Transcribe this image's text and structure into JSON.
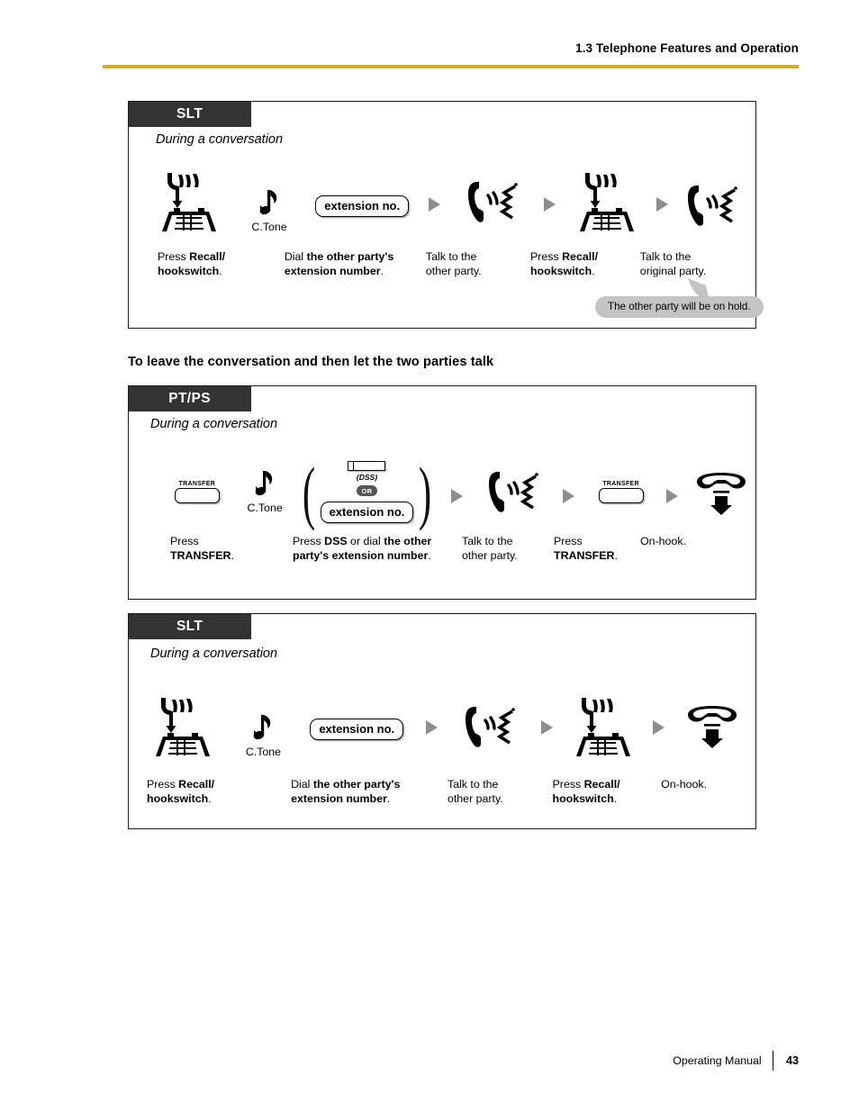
{
  "header": {
    "title": "1.3 Telephone Features and Operation",
    "rule_color": "#d4af16"
  },
  "section_heading": "To leave the conversation and then let the two parties talk",
  "boxes": [
    {
      "tab_label": "SLT",
      "state_label": "During a conversation",
      "steps": [
        {
          "icon": "recall-hookswitch-icon",
          "label": ""
        },
        {
          "icon": "c-tone-icon",
          "label": "C.Tone"
        },
        {
          "icon": "extension-no-pill",
          "label": "extension no."
        },
        {
          "icon": "talk-icon",
          "label": ""
        },
        {
          "icon": "recall-hookswitch-icon",
          "label": ""
        },
        {
          "icon": "talk-icon",
          "label": ""
        }
      ],
      "captions": [
        {
          "lead": "Press ",
          "strong": "Recall/",
          "strong2": "hookswitch",
          "tail": "."
        },
        {
          "lead": "Dial ",
          "strong": "the other party's",
          "strong2": "extension number",
          "tail": "."
        },
        {
          "plain1": "Talk to the",
          "plain2": "other party."
        },
        {
          "lead": "Press ",
          "strong": "Recall/",
          "strong2": "hookswitch",
          "tail": "."
        },
        {
          "plain1": "Talk to the",
          "plain2": "original party."
        }
      ],
      "callout": "The other party will be on hold."
    },
    {
      "tab_label": "PT/PS",
      "state_label": "During a conversation",
      "steps": [
        {
          "icon": "transfer-key",
          "label": "TRANSFER"
        },
        {
          "icon": "c-tone-icon",
          "label": "C.Tone"
        },
        {
          "icon": "dss-or-extension-group",
          "label": "(DSS)",
          "or_label": "OR",
          "pill_label": "extension no."
        },
        {
          "icon": "talk-icon",
          "label": ""
        },
        {
          "icon": "transfer-key",
          "label": "TRANSFER"
        },
        {
          "icon": "on-hook-icon",
          "label": ""
        }
      ],
      "captions": [
        {
          "plain1": "Press",
          "strongline": "TRANSFER",
          "tail": "."
        },
        {
          "lead": "Press ",
          "strong": "DSS",
          "mid": " or dial ",
          "strong2": "the other",
          "strong3": "party's extension number",
          "tail": "."
        },
        {
          "plain1": "Talk to the",
          "plain2": "other party."
        },
        {
          "plain1": "Press",
          "strongline": "TRANSFER",
          "tail": "."
        },
        {
          "plain1": "On-hook."
        }
      ]
    },
    {
      "tab_label": "SLT",
      "state_label": "During a conversation",
      "steps": [
        {
          "icon": "recall-hookswitch-icon",
          "label": ""
        },
        {
          "icon": "c-tone-icon",
          "label": "C.Tone"
        },
        {
          "icon": "extension-no-pill",
          "label": "extension no."
        },
        {
          "icon": "talk-icon",
          "label": ""
        },
        {
          "icon": "recall-hookswitch-icon",
          "label": ""
        },
        {
          "icon": "on-hook-icon",
          "label": ""
        }
      ],
      "captions": [
        {
          "lead": "Press ",
          "strong": "Recall/",
          "strong2": "hookswitch",
          "tail": "."
        },
        {
          "lead": "Dial ",
          "strong": "the other party's",
          "strong2": "extension number",
          "tail": "."
        },
        {
          "plain1": "Talk to the",
          "plain2": "other party."
        },
        {
          "lead": "Press ",
          "strong": "Recall/",
          "strong2": "hookswitch",
          "tail": "."
        },
        {
          "plain1": "On-hook."
        }
      ]
    }
  ],
  "footer": {
    "manual_label": "Operating Manual",
    "page_number": "43"
  }
}
